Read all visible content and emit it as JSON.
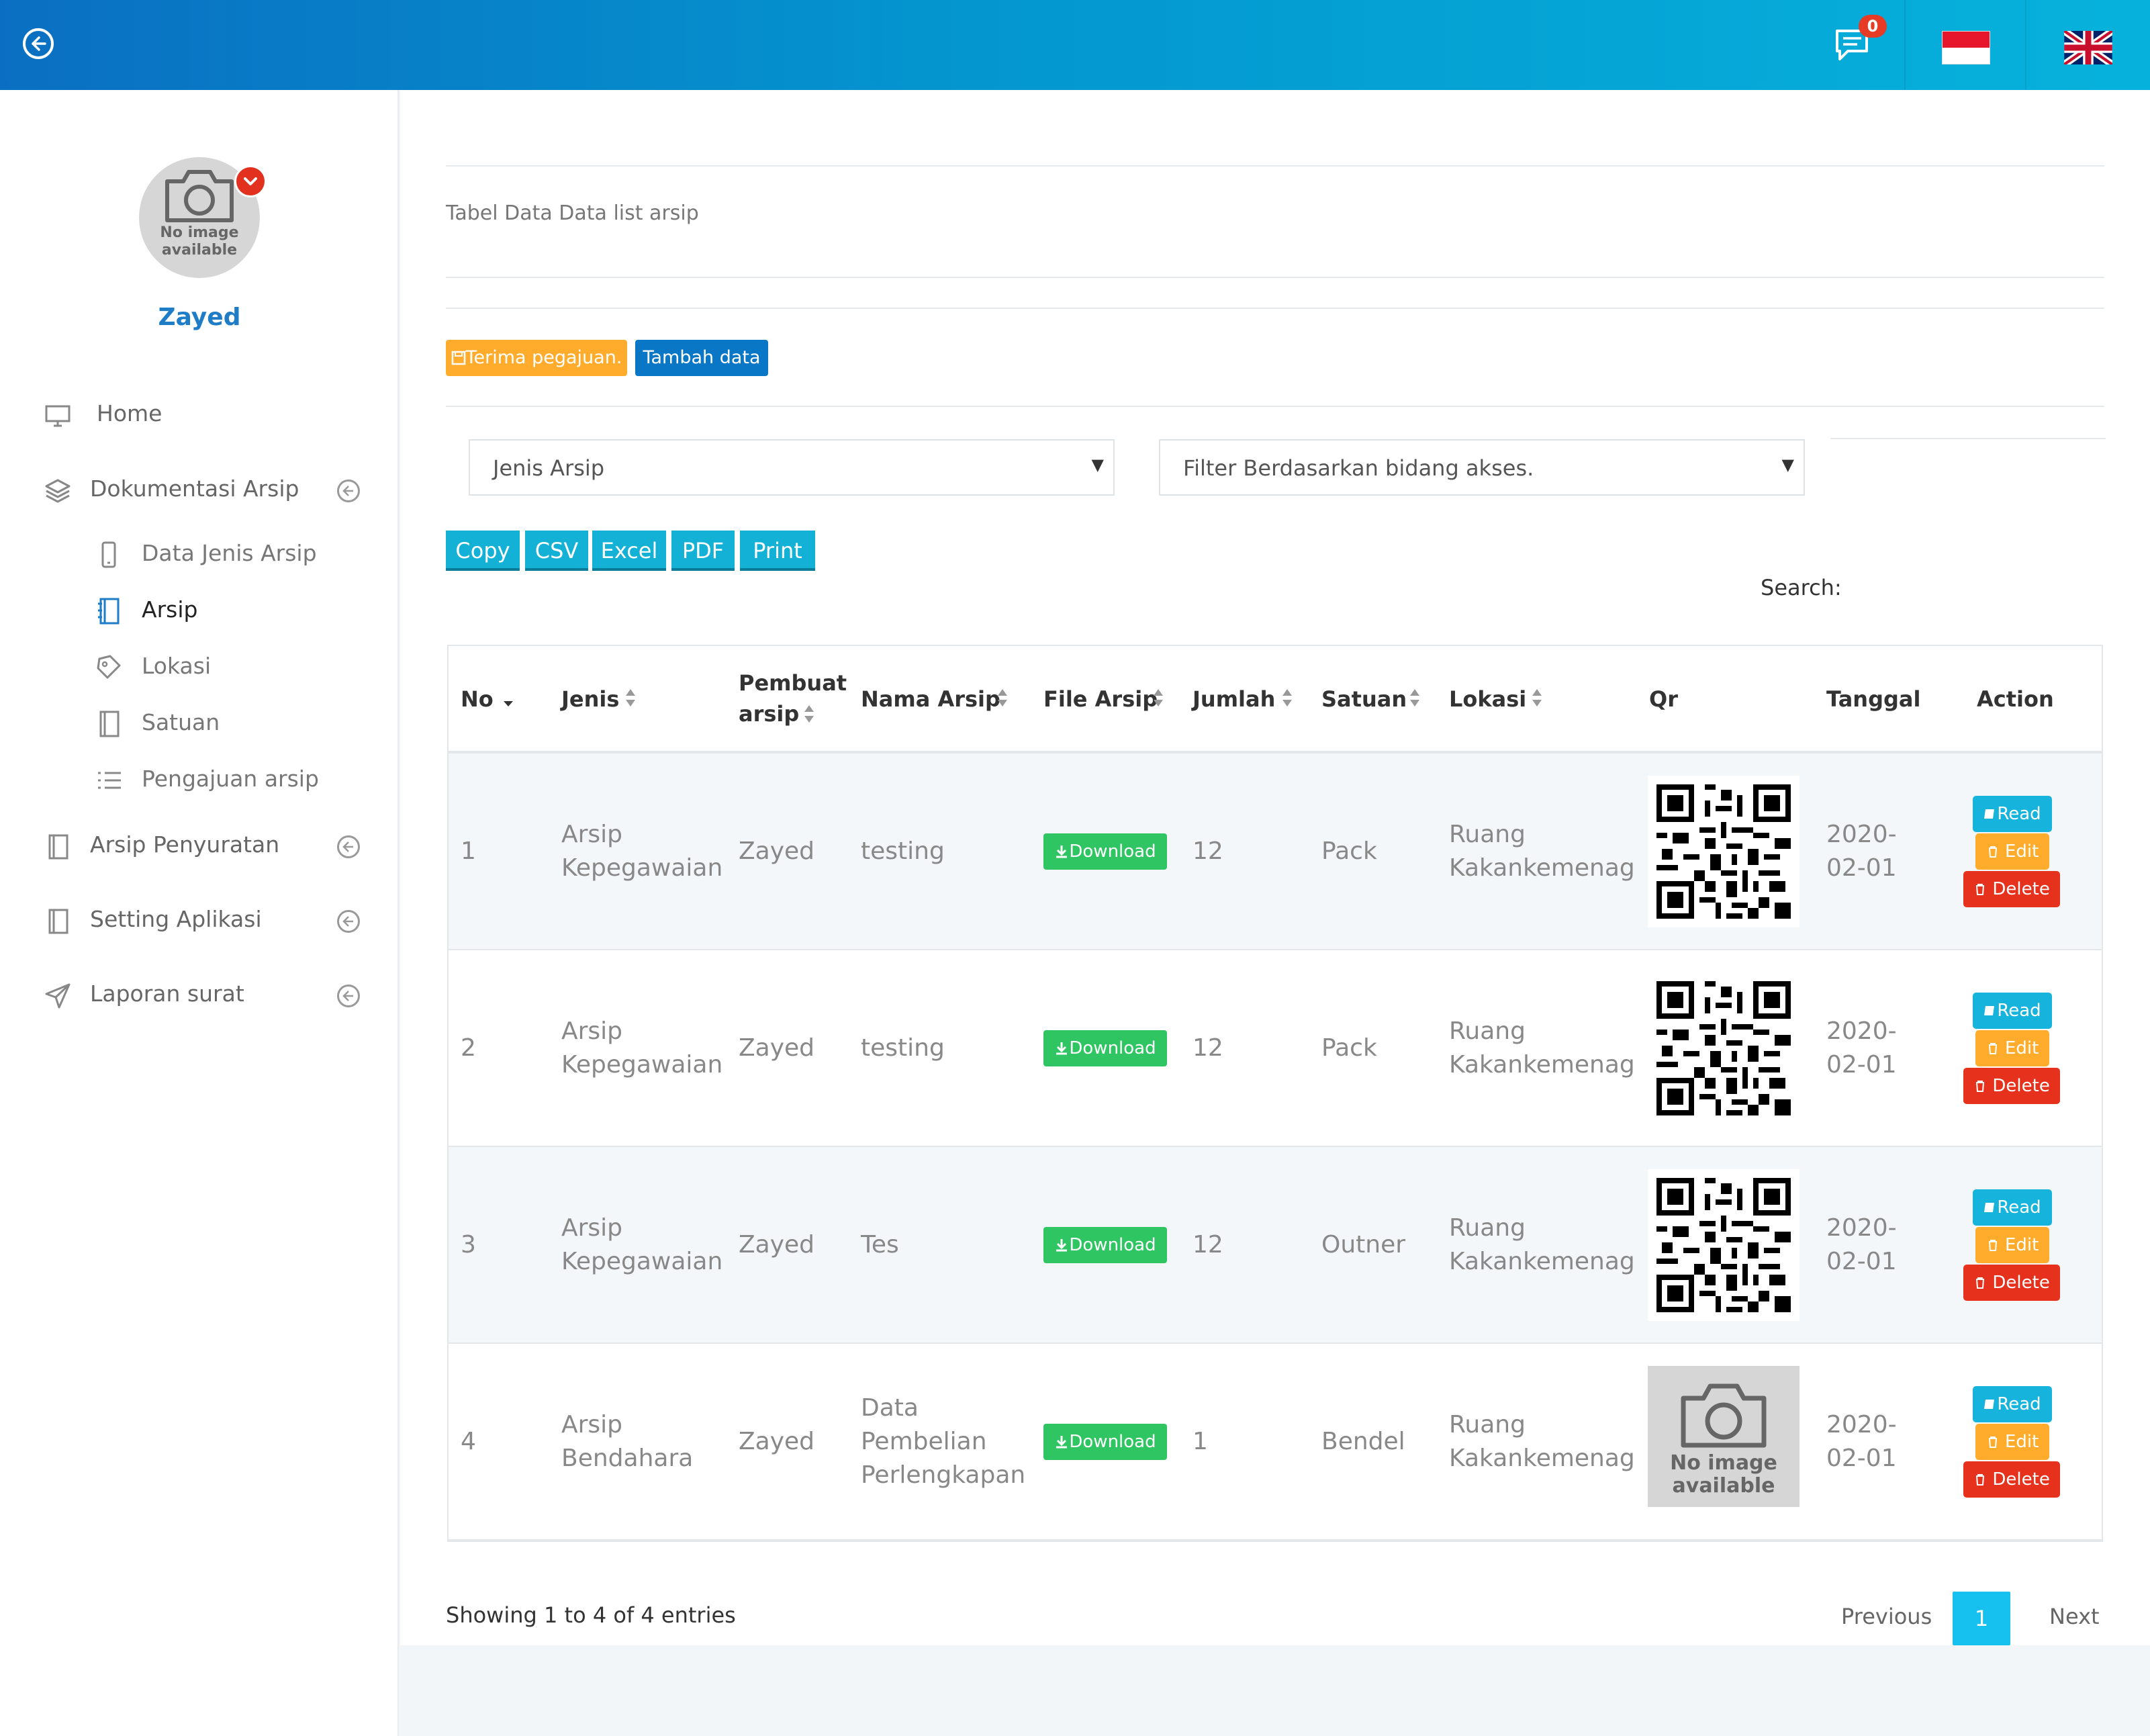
{
  "header": {
    "notification_count": "0",
    "colors": {
      "gradient_start": "#0a6fc2",
      "gradient_end": "#06b2dc"
    }
  },
  "sidebar": {
    "avatar_caption": "No image available",
    "profile_name": "Zayed",
    "items": [
      {
        "label": "Home",
        "icon": "monitor-icon"
      },
      {
        "label": "Dokumentasi Arsip",
        "icon": "layers-icon",
        "expandable": true
      },
      {
        "label": "Arsip Penyuratan",
        "icon": "notebook-icon",
        "expandable": true
      },
      {
        "label": "Setting Aplikasi",
        "icon": "notebook-icon",
        "expandable": true
      },
      {
        "label": "Laporan surat",
        "icon": "send-icon",
        "expandable": true
      }
    ],
    "subitems": [
      {
        "label": "Data Jenis Arsip",
        "icon": "phone-icon"
      },
      {
        "label": "Arsip",
        "icon": "notebook-icon",
        "active": true
      },
      {
        "label": "Lokasi",
        "icon": "pin-tag-icon"
      },
      {
        "label": "Satuan",
        "icon": "notebook-icon"
      },
      {
        "label": "Pengajuan arsip",
        "icon": "list-icon"
      }
    ]
  },
  "main": {
    "title": "Tabel Data Data list arsip",
    "buttons": {
      "accept": "Terima pegajuan.",
      "add": "Tambah data"
    },
    "filters": {
      "jenis": "Jenis Arsip",
      "bidang": "Filter Berdasarkan bidang akses."
    },
    "export_buttons": [
      "Copy",
      "CSV",
      "Excel",
      "PDF",
      "Print"
    ],
    "search_label": "Search:"
  },
  "table": {
    "headers": [
      "No",
      "Jenis",
      "Pembuat arsip",
      "Nama Arsip",
      "File Arsip",
      "Jumlah",
      "Satuan",
      "Lokasi",
      "Qr",
      "Tanggal",
      "Action"
    ],
    "download_label": "Download",
    "action_labels": {
      "read": "Read",
      "edit": "Edit",
      "delete": "Delete"
    },
    "rows": [
      {
        "no": "1",
        "jenis": "Arsip Kepegawaian",
        "pembuat": "Zayed",
        "nama": "testing",
        "jumlah": "12",
        "satuan": "Pack",
        "lokasi": "Ruang Kakankemenag",
        "tanggal": "2020-02-01",
        "qr": "qr-code"
      },
      {
        "no": "2",
        "jenis": "Arsip Kepegawaian",
        "pembuat": "Zayed",
        "nama": "testing",
        "jumlah": "12",
        "satuan": "Pack",
        "lokasi": "Ruang Kakankemenag",
        "tanggal": "2020-02-01",
        "qr": "qr-code"
      },
      {
        "no": "3",
        "jenis": "Arsip Kepegawaian",
        "pembuat": "Zayed",
        "nama": "Tes",
        "jumlah": "12",
        "satuan": "Outner",
        "lokasi": "Ruang Kakankemenag",
        "tanggal": "2020-02-01",
        "qr": "qr-code"
      },
      {
        "no": "4",
        "jenis": "Arsip Bendahara",
        "pembuat": "Zayed",
        "nama": "Data Pembelian Perlengkapan",
        "jumlah": "1",
        "satuan": "Bendel",
        "lokasi": "Ruang Kakankemenag",
        "tanggal": "2020-02-01",
        "qr": "no-image",
        "qr_caption": "No image available"
      }
    ]
  },
  "footer": {
    "info": "Showing 1 to 4 of 4 entries",
    "previous": "Previous",
    "current_page": "1",
    "next": "Next"
  }
}
